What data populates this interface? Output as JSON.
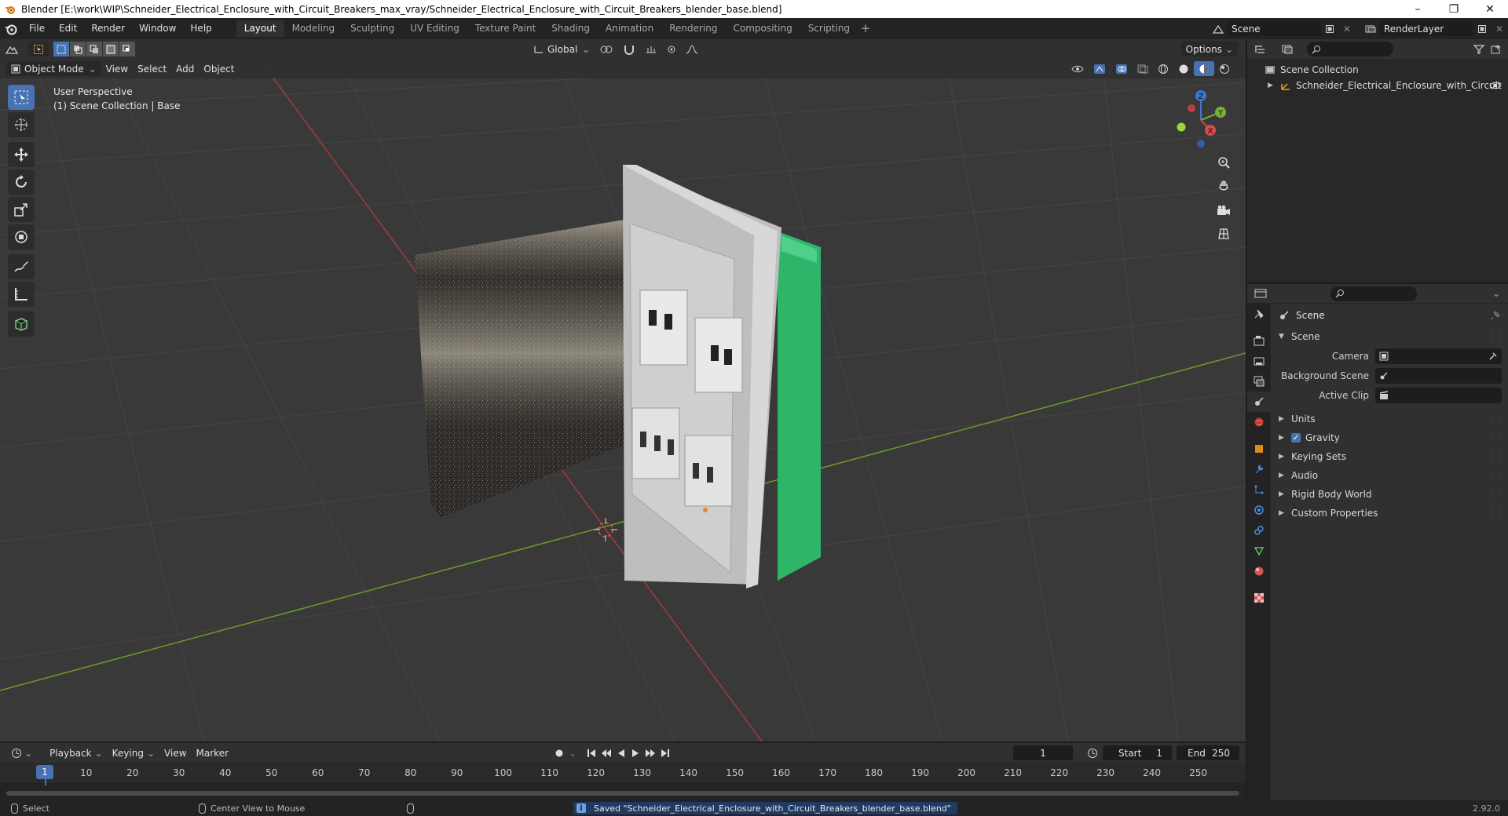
{
  "window": {
    "title": "Blender [E:\\work\\WIP\\Schneider_Electrical_Enclosure_with_Circuit_Breakers_max_vray/Schneider_Electrical_Enclosure_with_Circuit_Breakers_blender_base.blend]",
    "minimize": "–",
    "maximize": "❐",
    "close": "✕"
  },
  "menubar": {
    "items": [
      "File",
      "Edit",
      "Render",
      "Window",
      "Help"
    ],
    "workspaces": [
      "Layout",
      "Modeling",
      "Sculpting",
      "UV Editing",
      "Texture Paint",
      "Shading",
      "Animation",
      "Rendering",
      "Compositing",
      "Scripting"
    ],
    "active_workspace": "Layout",
    "add_workspace": "+",
    "scene": "Scene",
    "view_layer": "RenderLayer"
  },
  "viewport": {
    "mode": "Object Mode",
    "menus": [
      "View",
      "Select",
      "Add",
      "Object"
    ],
    "transform_orientation": "Global",
    "options_label": "Options",
    "perspective_label": "User Perspective",
    "collection_label": "(1) Scene Collection | Base",
    "tools": [
      "select-box",
      "cursor",
      "move",
      "rotate",
      "scale",
      "transform",
      "annotate",
      "measure",
      "add-cube"
    ],
    "gizmo_axes": {
      "x": "X",
      "y": "Y",
      "z": "Z"
    },
    "colors": {
      "x_axis": "#a83a3a",
      "y_axis": "#6d9b2c",
      "accent": "#4772b3"
    }
  },
  "outliner": {
    "root": "Scene Collection",
    "items": [
      {
        "name": "Schneider_Electrical_Enclosure_with_Circuit",
        "visible": true
      }
    ]
  },
  "properties": {
    "title": "Scene",
    "panel": "Scene",
    "fields": [
      {
        "label": "Camera",
        "value": ""
      },
      {
        "label": "Background Scene",
        "value": ""
      },
      {
        "label": "Active Clip",
        "value": ""
      }
    ],
    "subpanels": [
      {
        "label": "Units",
        "checkbox": false
      },
      {
        "label": "Gravity",
        "checkbox": true
      },
      {
        "label": "Keying Sets",
        "checkbox": false
      },
      {
        "label": "Audio",
        "checkbox": false
      },
      {
        "label": "Rigid Body World",
        "checkbox": false
      },
      {
        "label": "Custom Properties",
        "checkbox": false
      }
    ]
  },
  "timeline": {
    "menus": [
      "Playback",
      "Keying",
      "View",
      "Marker"
    ],
    "current_frame": "1",
    "start_label": "Start",
    "start": "1",
    "end_label": "End",
    "end": "250",
    "ticks": [
      "1",
      "10",
      "20",
      "30",
      "40",
      "50",
      "60",
      "70",
      "80",
      "90",
      "100",
      "110",
      "120",
      "130",
      "140",
      "150",
      "160",
      "170",
      "180",
      "190",
      "200",
      "210",
      "220",
      "230",
      "240",
      "250"
    ]
  },
  "statusbar": {
    "select": "Select",
    "center_view": "Center View to Mouse",
    "saved_message": "Saved \"Schneider_Electrical_Enclosure_with_Circuit_Breakers_blender_base.blend\"",
    "version": "2.92.0"
  }
}
